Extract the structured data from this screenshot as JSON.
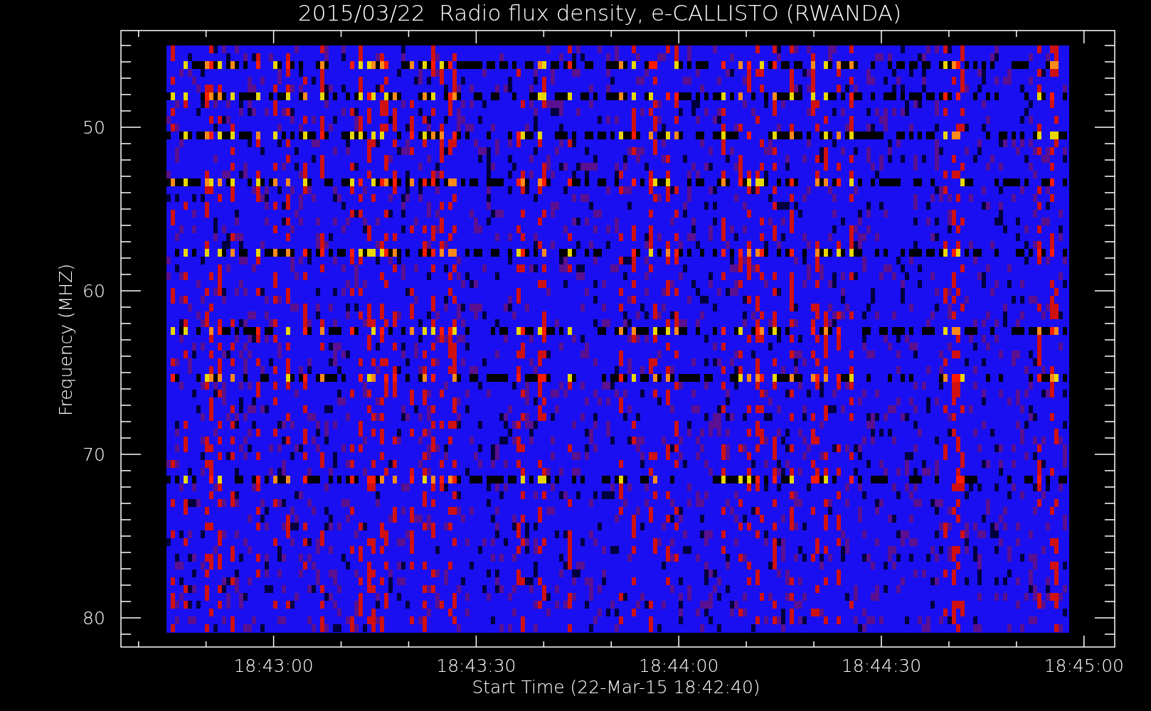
{
  "plot": {
    "title": "2015/03/22  Radio flux density, e-CALLISTO (RWANDA)",
    "ylabel": "Frequency (MHZ)",
    "xlabel": "Start Time (22-Mar-15 18:42:40)",
    "yticks": [
      "50",
      "60",
      "70",
      "80"
    ],
    "xticks": [
      "18:43:00",
      "18:43:30",
      "18:44:00",
      "18:44:30",
      "18:45:00"
    ]
  }
}
